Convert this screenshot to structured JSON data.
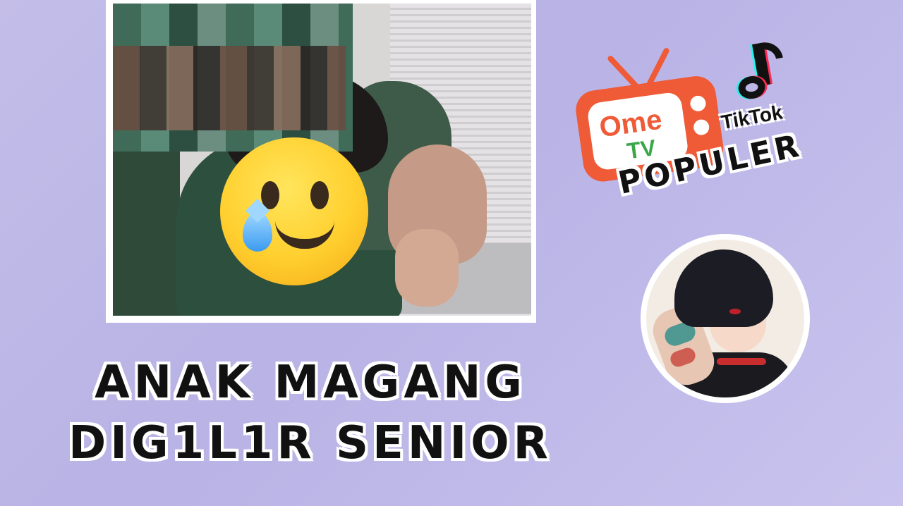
{
  "photo": {
    "watermark": ""
  },
  "overlay": {
    "emoji_icon": "crying-smiling-face-icon"
  },
  "headline": {
    "line1": "ANAK MAGANG",
    "line2": "DIG1L1R SENIOR"
  },
  "ometv_logo": {
    "ome": "Ome",
    "tv": "TV",
    "colors": {
      "orange": "#ef5a37",
      "green": "#3aa84a"
    }
  },
  "tiktok_logo": {
    "label": "TikTok",
    "icon": "tiktok-note-icon"
  },
  "tag": {
    "text": "POPULER"
  },
  "avatar": {
    "icon": "anime-avatar-icon"
  },
  "colors": {
    "background": "#c3bde8",
    "text": "#111111",
    "outline": "#ffffff"
  }
}
